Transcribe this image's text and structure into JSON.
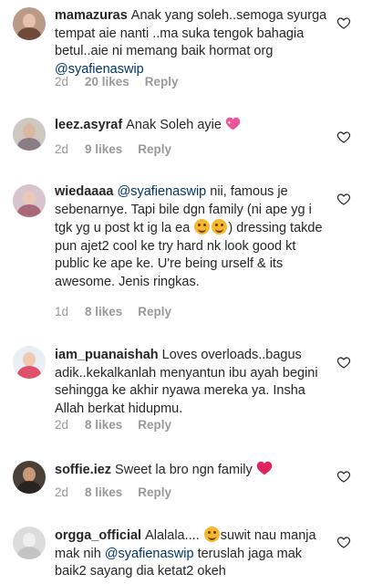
{
  "colors": {
    "text": "#262626",
    "meta": "#999999",
    "mention": "#003569",
    "heart": "#e0245e"
  },
  "comments": [
    {
      "username": "mamazuras",
      "parts": [
        "Anak yang soleh..semoga syurga tempat aie nanti ..ma suka tengok bahagia betul..aie ni memang baik hormat org"
      ],
      "mention_end": "@syafienaswip",
      "time": "2d",
      "likes": "20 likes",
      "reply": "Reply"
    },
    {
      "username": "leez.asyraf",
      "text": "Anak Soleh ayie",
      "emoji": "sparkling-heart",
      "time": "2d",
      "likes": "9 likes",
      "reply": "Reply"
    },
    {
      "username": "wiedaaaa",
      "mention_start": "@syafienaswip",
      "text_a": "nii, famous je sebenarnye. Tapi bile dgn family (ni ape yg i tgk yg u post kt ig la ea",
      "text_b": ") dressing takde pun ajet2 cool ke try hard nk look good kt public ke ape ke. U're being urself & its awesome. Jenis ringkas.",
      "time": "1d",
      "likes": "8 likes",
      "reply": "Reply"
    },
    {
      "username": "iam_puanaishah",
      "text": "Loves overloads..bagus adik..kekalkanlah menyantun ibu ayah begini sehingga ke akhir nyawa mereka ya. Insha Allah berkat hidupmu.",
      "time": "2d",
      "likes": "8 likes",
      "reply": "Reply"
    },
    {
      "username": "soffie.iez",
      "text": "Sweet la bro ngn family",
      "emoji": "red-heart",
      "time": "2d",
      "likes": "8 likes",
      "reply": "Reply"
    },
    {
      "username": "orgga_official",
      "text_a": "Alalala....",
      "text_b": "suwit nau manja mak nih",
      "mention_mid": "@syafienaswip",
      "text_c": "teruslah jaga mak baik2 sayang dia ketat2 okeh"
    }
  ]
}
